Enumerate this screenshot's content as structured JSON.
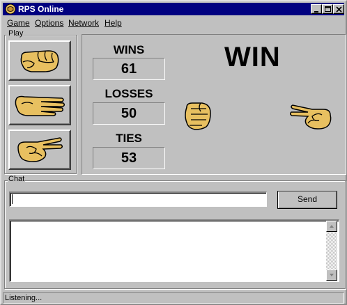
{
  "window": {
    "title": "RPS Online"
  },
  "menu": {
    "items": [
      {
        "label": "Game"
      },
      {
        "label": "Options"
      },
      {
        "label": "Network"
      },
      {
        "label": "Help"
      }
    ]
  },
  "play": {
    "group_label": "Play",
    "buttons": [
      {
        "name": "rock",
        "icon": "rock-fist-icon"
      },
      {
        "name": "paper",
        "icon": "paper-hand-icon"
      },
      {
        "name": "scissors",
        "icon": "scissors-hand-icon"
      }
    ]
  },
  "scoreboard": {
    "wins_label": "WINS",
    "wins": "61",
    "losses_label": "LOSSES",
    "losses": "50",
    "ties_label": "TIES",
    "ties": "53",
    "result": "WIN",
    "player_hand": "rock-fist-icon",
    "opponent_hand": "scissors-hand-icon"
  },
  "chat": {
    "group_label": "Chat",
    "input_value": "",
    "send_label": "Send",
    "log": ""
  },
  "status": {
    "text": "Listening..."
  },
  "colors": {
    "titlebar": "#000080",
    "face": "#c0c0c0",
    "hand": "#e8c060"
  }
}
